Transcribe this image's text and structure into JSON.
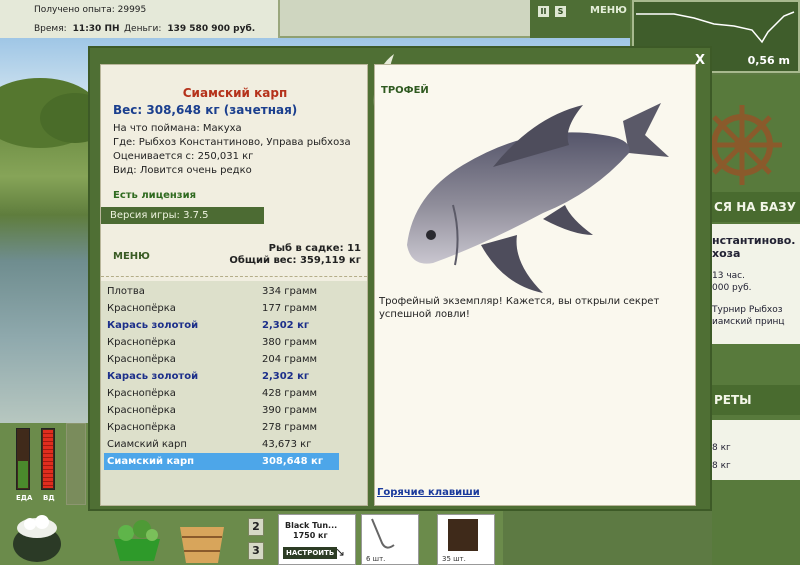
{
  "topbar": {
    "experience_label": "Получено опыта:",
    "experience_value": "29995",
    "time_label": "Время:",
    "time_value": "11:30 ПН",
    "money_label": "Деньги:",
    "money_value": "139 580 900 руб.",
    "menu_label": "МЕНЮ"
  },
  "depth": {
    "value": "0,56 m"
  },
  "right_panel": {
    "base_label": "СЯ НА БАЗУ",
    "lines": [
      "нстантиново.",
      "хоза"
    ],
    "info": [
      "13 час.",
      "000 руб.",
      "Турнир Рыбхоз",
      "иамский принц"
    ],
    "secrets_label": "РЕТЫ",
    "weights": [
      "8 кг",
      "8 кг"
    ]
  },
  "bottom": {
    "meter_left_label": "ЕДА",
    "meter_right_label": "ВД",
    "slot_numbers": [
      "2",
      "3"
    ],
    "lure_name": "Black Tun...",
    "lure_weight": "1750 кг",
    "setup_label": "НАСТРОИТЬ",
    "hook_count": "6 шт.",
    "bait_count": "35 шт."
  },
  "dialog": {
    "close_label": "X",
    "fish_name": "Сиамский карп",
    "fish_weight": "Вес: 308,648 кг (зачетная)",
    "details": [
      "На что поймана: Макуха",
      "Где: Рыбхоз Константиново, Управа рыбхоза",
      "Оценивается с: 250,031 кг",
      "Вид: Ловится очень редко"
    ],
    "license": "Есть лицензия",
    "version": "Версия игры: 3.7.5",
    "menu_label": "МЕНЮ",
    "cage_count": "Рыб в садке: 11",
    "cage_weight": "Общий вес: 359,119 кг",
    "catch": [
      {
        "name": "Плотва",
        "weight": "334 грамм",
        "style": "normal"
      },
      {
        "name": "Краснопёрка",
        "weight": "177 грамм",
        "style": "normal"
      },
      {
        "name": "Карась золотой",
        "weight": "2,302 кг",
        "style": "golden"
      },
      {
        "name": "Краснопёрка",
        "weight": "380 грамм",
        "style": "normal"
      },
      {
        "name": "Краснопёрка",
        "weight": "204 грамм",
        "style": "normal"
      },
      {
        "name": "Карась золотой",
        "weight": "2,302 кг",
        "style": "golden"
      },
      {
        "name": "Краснопёрка",
        "weight": "428 грамм",
        "style": "normal"
      },
      {
        "name": "Краснопёрка",
        "weight": "390 грамм",
        "style": "normal"
      },
      {
        "name": "Краснопёрка",
        "weight": "278 грамм",
        "style": "normal"
      },
      {
        "name": "Сиамский карп",
        "weight": "43,673 кг",
        "style": "normal"
      },
      {
        "name": "Сиамский карп",
        "weight": "308,648 кг",
        "style": "sel"
      }
    ],
    "trophy_title": "ТРОФЕЙ",
    "trophy_text": "Трофейный экземпляр! Кажется, вы открыли секрет успешной ловли!",
    "hotkeys_label": "Горячие клавиши"
  }
}
